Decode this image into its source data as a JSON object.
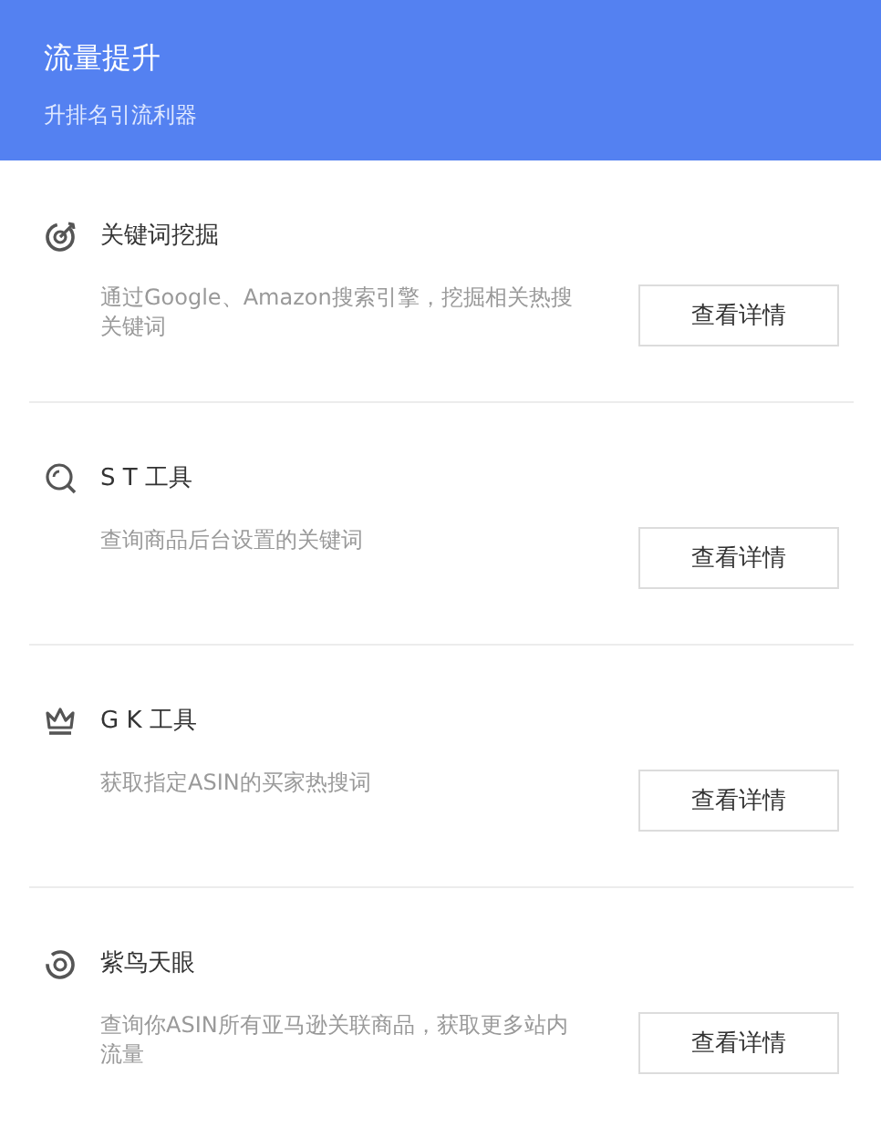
{
  "header": {
    "title": "流量提升",
    "subtitle": "升排名引流利器"
  },
  "tools": [
    {
      "name": "关键词挖掘",
      "description": "通过Google、Amazon搜索引擎，挖掘相关热搜关键词",
      "button": "查看详情"
    },
    {
      "name": "S T 工具",
      "description": "查询商品后台设置的关键词",
      "button": "查看详情"
    },
    {
      "name": "G K 工具",
      "description": "获取指定ASIN的买家热搜词",
      "button": "查看详情"
    },
    {
      "name": "紫鸟天眼",
      "description": "查询你ASIN所有亚马逊关联商品，获取更多站内流量",
      "button": "查看详情"
    }
  ]
}
